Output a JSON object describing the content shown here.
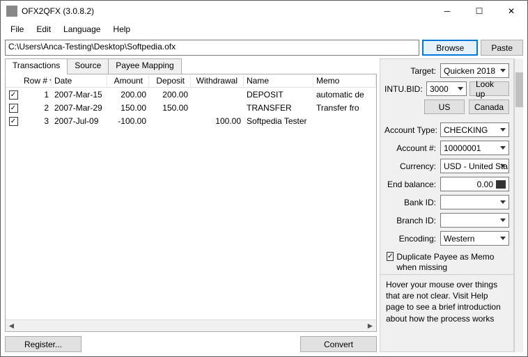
{
  "window": {
    "title": "OFX2QFX (3.0.8.2)"
  },
  "menu": {
    "file": "File",
    "edit": "Edit",
    "language": "Language",
    "help": "Help"
  },
  "path": {
    "value": "C:\\Users\\Anca-Testing\\Desktop\\Softpedia.ofx",
    "browse": "Browse",
    "paste": "Paste"
  },
  "tabs": {
    "transactions": "Transactions",
    "source": "Source",
    "payee": "Payee Mapping"
  },
  "columns": {
    "row": "Row #",
    "date": "Date",
    "amount": "Amount",
    "deposit": "Deposit",
    "withdrawal": "Withdrawal",
    "name": "Name",
    "memo": "Memo"
  },
  "rows": [
    {
      "n": "1",
      "date": "2007-Mar-15",
      "amount": "200.00",
      "deposit": "200.00",
      "withdrawal": "",
      "name": "DEPOSIT",
      "memo": "automatic de"
    },
    {
      "n": "2",
      "date": "2007-Mar-29",
      "amount": "150.00",
      "deposit": "150.00",
      "withdrawal": "",
      "name": "TRANSFER",
      "memo": "Transfer fro"
    },
    {
      "n": "3",
      "date": "2007-Jul-09",
      "amount": "-100.00",
      "deposit": "",
      "withdrawal": "100.00",
      "name": "Softpedia Tester",
      "memo": ""
    }
  ],
  "side": {
    "target_lbl": "Target:",
    "target_val": "Quicken 2018",
    "intu_lbl": "INTU.BID:",
    "intu_val": "3000",
    "lookup": "Look up",
    "us": "US",
    "canada": "Canada",
    "acct_type_lbl": "Account Type:",
    "acct_type_val": "CHECKING",
    "acct_num_lbl": "Account #:",
    "acct_num_val": "10000001",
    "currency_lbl": "Currency:",
    "currency_val": "USD - United Sta",
    "endbal_lbl": "End balance:",
    "endbal_val": "0.00",
    "bankid_lbl": "Bank ID:",
    "bankid_val": "",
    "branchid_lbl": "Branch ID:",
    "branchid_val": "",
    "encoding_lbl": "Encoding:",
    "encoding_val": "Western",
    "dup_label": "Duplicate Payee as Memo when missing",
    "hint": "Hover your mouse over things that are not clear. Visit Help page to see a brief introduction about how the process works"
  },
  "bottom": {
    "register": "Register...",
    "convert": "Convert"
  }
}
